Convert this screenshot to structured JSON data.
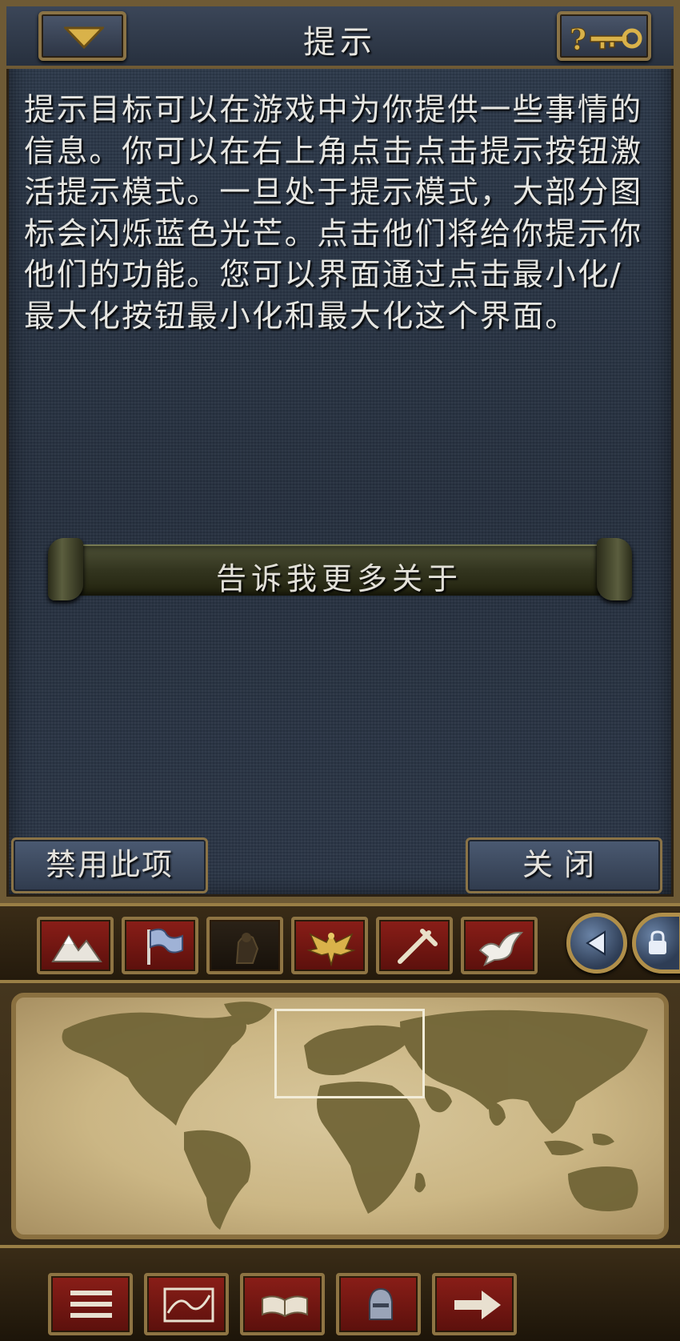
{
  "hint_panel": {
    "title": "提示",
    "message": "提示目标可以在游戏中为你提供一些事情的信息。你可以在右上角点击点击提示按钮激活提示模式。一旦处于提示模式，大部分图标会闪烁蓝色光芒。点击他们将给你提示你他们的功能。您可以界面通过点击最小化/最大化按钮最小化和最大化这个界面。",
    "tell_more_label": "告诉我更多关于",
    "disable_label": "禁用此项",
    "close_label": "关闭"
  },
  "icons": {
    "minimize": "chevron-down-icon",
    "help": "question-key-icon",
    "map_modes": [
      "terrain-icon",
      "political-flag-icon",
      "province-icon",
      "eagle-icon",
      "trade-icon",
      "diplomacy-dove-icon"
    ],
    "navigation": [
      "back-arrow-icon",
      "lock-icon",
      "zoom-in-icon",
      "zoom-out-icon"
    ],
    "bottom_tools": [
      "ledger-icon",
      "map-icon",
      "book-icon",
      "military-icon",
      "next-arrow-icon"
    ]
  },
  "colors": {
    "panel_bg": "#2a3444",
    "frame_gold": "#8a7346",
    "button_red": "#8a1e18",
    "map_parchment": "#cbb684",
    "land_olive": "#6f6335"
  }
}
